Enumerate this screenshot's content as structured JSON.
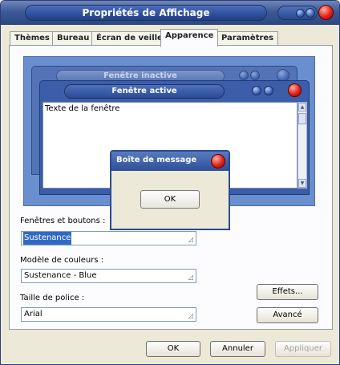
{
  "window": {
    "title": "Propriétés de Affichage"
  },
  "tabs": [
    "Thèmes",
    "Bureau",
    "Écran de veille",
    "Apparence",
    "Paramètres"
  ],
  "active_tab": "Apparence",
  "preview": {
    "inactive_title": "Fenêtre inactive",
    "active_title": "Fenêtre active",
    "window_text": "Texte de la fenêtre",
    "msgbox_title": "Boîte de message",
    "msgbox_ok": "OK"
  },
  "form": {
    "windows_label": "Fenêtres et boutons :",
    "windows_value": "Sustenance",
    "colors_label": "Modèle de couleurs :",
    "colors_value": "Sustenance - Blue",
    "font_label": "Taille de police :",
    "font_value": "Arial",
    "effects_button": "Effets...",
    "advanced_button": "Avancé"
  },
  "footer": {
    "ok": "OK",
    "cancel": "Annuler",
    "apply": "Appliquer"
  },
  "colors": {
    "titlebar": "#3d5a96",
    "close_red": "#e0221a",
    "preview_bg": "#6a8fce",
    "selection": "#316ac5",
    "dialog_bg": "#ece9d8"
  }
}
